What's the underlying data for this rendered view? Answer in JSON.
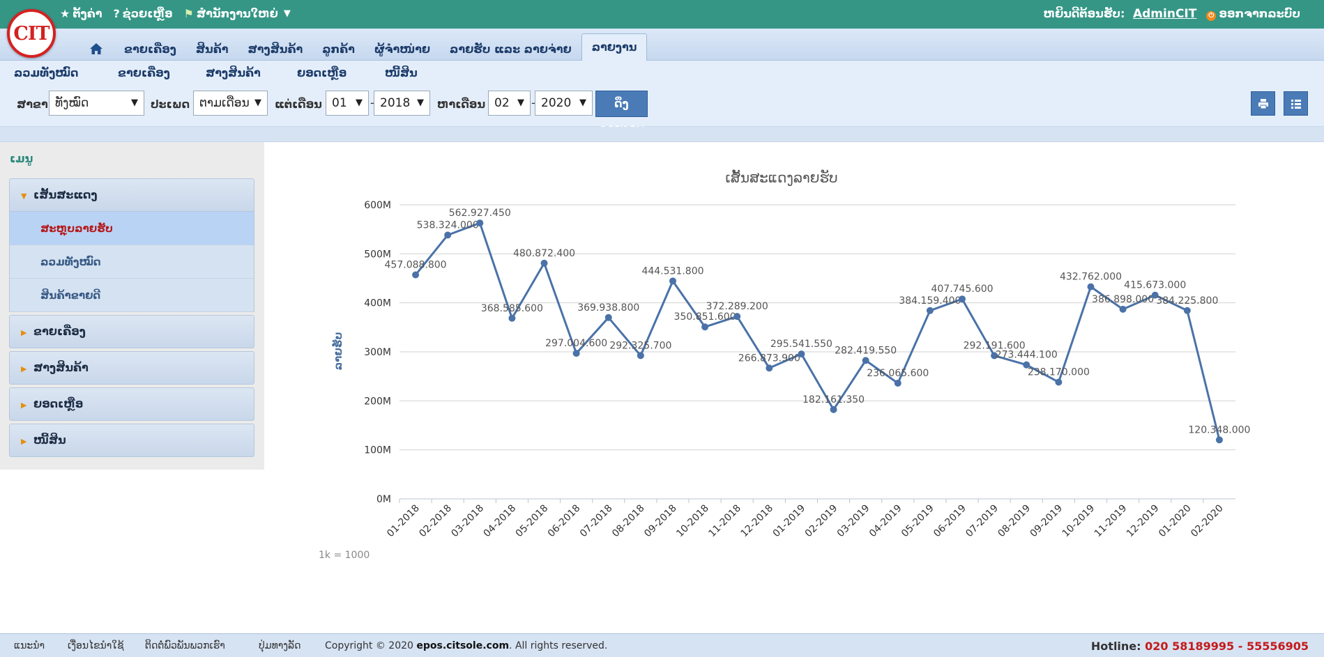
{
  "logo": {
    "text": "CIT"
  },
  "top_links": [
    {
      "icon": "star-icon",
      "glyph": "★",
      "label": "ຕັ້ງຄ່າ"
    },
    {
      "icon": "question-icon",
      "glyph": "?",
      "label": "ຊ່ວຍເຫຼືອ"
    },
    {
      "icon": "office-icon",
      "glyph": "⚑",
      "label": "ສຳນັກງານໃຫຍ່"
    }
  ],
  "top_right": {
    "welcome": "ຫຍິນດີຕ້ອນຮັບ:",
    "user": "AdminCIT",
    "logout": "ອອກຈາກລະບົບ"
  },
  "main_tabs": [
    "ຂາຍເຄື່ອງ",
    "ສິນຄ້າ",
    "ສາງສິນຄ້າ",
    "ລູກຄ້າ",
    "ຜູ້ຈຳໜ່າຍ",
    "ລາຍຮັບ ແລະ ລາຍຈ່າຍ",
    "ລາຍງານ"
  ],
  "active_tab": "ລາຍງານ",
  "sub_menu": [
    "ລວມທັງໝົດ",
    "ຂາຍເຄື່ອງ",
    "ສາງສິນຄ້າ",
    "ຍອດເຫຼືອ",
    "ໜີ້ສິນ"
  ],
  "filters": {
    "branch_label": "ສາຂາ",
    "branch_value": "ທັງໝົດ",
    "type_label": "ປະເພດ",
    "type_value": "ຕາມເດືອນ",
    "from_label": "ແຕ່ເດືອນ",
    "from_month": "01",
    "from_year": "2018",
    "to_label": "ຫາເດືອນ",
    "to_month": "02",
    "to_year": "2020",
    "report_button": "ດຶງລາຍງານ",
    "dash": "-"
  },
  "sidebar": {
    "title": "ເມນູ",
    "sections": [
      {
        "label": "ເສັ້ນສະແດງ",
        "open": true,
        "items": [
          "ສະຫຼຸບລາຍຮັບ",
          "ລວມທັງໝົດ",
          "ສິນຄ້າຂາຍດີ"
        ],
        "active_item": "ສະຫຼຸບລາຍຮັບ"
      },
      {
        "label": "ຂາຍເຄື່ອງ",
        "open": false
      },
      {
        "label": "ສາງສິນຄ້າ",
        "open": false
      },
      {
        "label": "ຍອດເຫຼືອ",
        "open": false
      },
      {
        "label": "ໜີ້ສິນ",
        "open": false
      }
    ]
  },
  "chart_data": {
    "type": "line",
    "title": "ເສັ້ນສະແດງລາຍຮັບ",
    "xlabel": "",
    "ylabel": "ລາຍຮັບ",
    "ylim": [
      0,
      600000000
    ],
    "y_ticks": [
      "0M",
      "100M",
      "200M",
      "300M",
      "400M",
      "500M",
      "600M"
    ],
    "grid": true,
    "note": "1k = 1000",
    "color": "#4a72a8",
    "categories": [
      "01-2018",
      "02-2018",
      "03-2018",
      "04-2018",
      "05-2018",
      "06-2018",
      "07-2018",
      "08-2018",
      "09-2018",
      "10-2018",
      "11-2018",
      "12-2018",
      "01-2019",
      "02-2019",
      "03-2019",
      "04-2019",
      "05-2019",
      "06-2019",
      "07-2019",
      "08-2019",
      "09-2019",
      "10-2019",
      "11-2019",
      "12-2019",
      "01-2020",
      "02-2020"
    ],
    "values": [
      457088800,
      538324000,
      562927450,
      368585600,
      480872400,
      297004600,
      369938800,
      292325700,
      444531800,
      350851600,
      372289200,
      266873900,
      295541550,
      182161350,
      282419550,
      236065600,
      384159400,
      407745600,
      292191600,
      273444100,
      238170000,
      432762000,
      386898000,
      415673000,
      384225800,
      120348000
    ],
    "labels": [
      "457.088.800",
      "538.324.000",
      "562.927.450",
      "368.585.600",
      "480.872.400",
      "297.004.600",
      "369.938.800",
      "292.325.700",
      "444.531.800",
      "350.851.600",
      "372.289.200",
      "266.873.900",
      "295.541.550",
      "182.161.350",
      "282.419.550",
      "236.065.600",
      "384.159.400",
      "407.745.600",
      "292.191.600",
      "273.444.100",
      "238.170.000",
      "432.762.000",
      "386.898.000",
      "415.673.000",
      "384.225.800",
      "120.348.000"
    ]
  },
  "footer": {
    "links": [
      "ແນະນຳ",
      "ເງື່ອນໄຂນຳໃຊ້",
      "ຕິດຕໍ່ພົວພັນພວກເຮົາ",
      "ປຸ່ມທາງລັດ"
    ],
    "copyright_prefix": "Copyright © 2020",
    "copyright_site": "epos.citsole.com",
    "copyright_suffix": ". All rights reserved.",
    "hotline_label": "Hotline:",
    "hotline_number": "020 58189995 - 55556905"
  }
}
